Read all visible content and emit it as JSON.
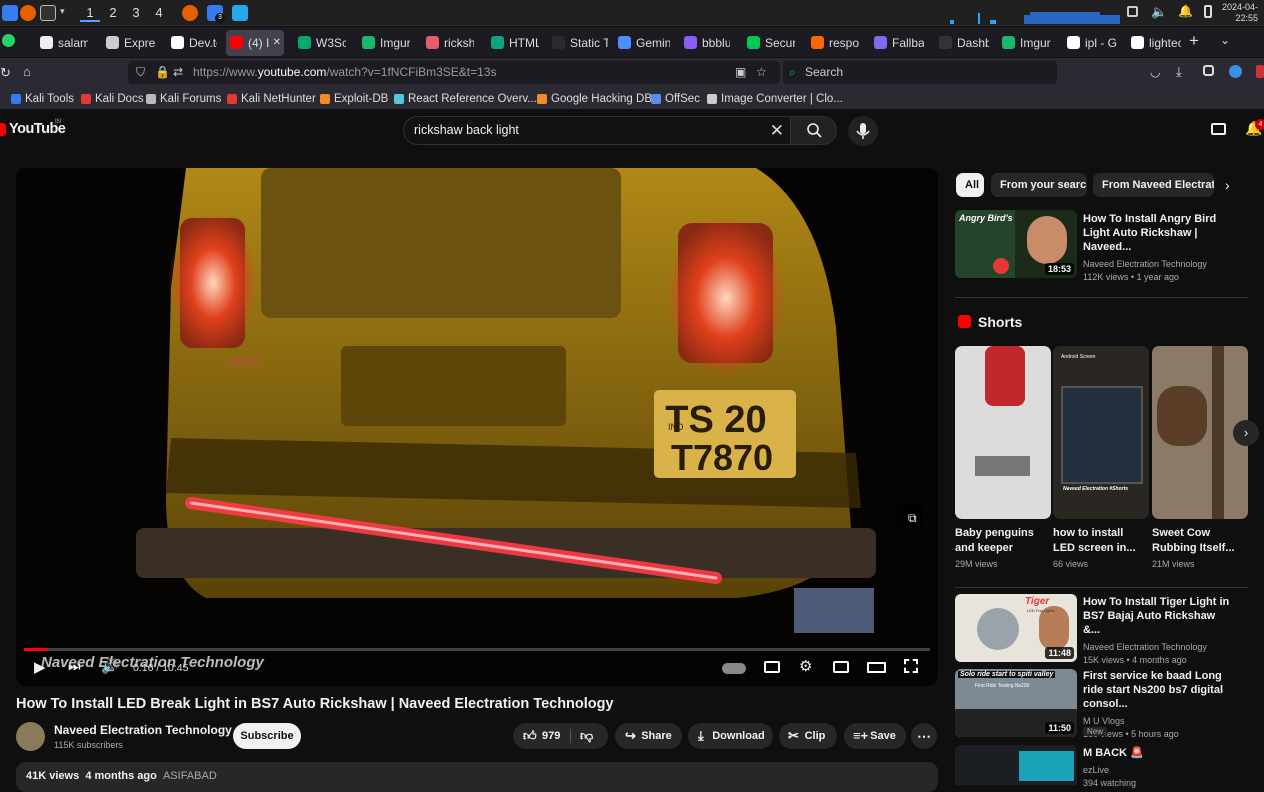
{
  "taskbar": {
    "workspaces": [
      "1",
      "2",
      "3",
      "4"
    ],
    "active_workspace": "1",
    "clock_date": "2024-04-",
    "clock_time": "22:55",
    "badge": "3"
  },
  "browser_tabs": [
    {
      "label": "salam",
      "color": "#eeeeee"
    },
    {
      "label": "Expres",
      "color": "#cccccc"
    },
    {
      "label": "Dev.to",
      "color": "#ffffff"
    },
    {
      "label": "(4) I",
      "color": "#ff0000"
    },
    {
      "label": "W3Sch",
      "color": "#04aa6d"
    },
    {
      "label": "Imgur",
      "color": "#1bb76e"
    },
    {
      "label": "ricksha",
      "color": "#e35d6a"
    },
    {
      "label": "HTML",
      "color": "#10a37f"
    },
    {
      "label": "Static Tem",
      "color": "#2b2a33"
    },
    {
      "label": "Gemini",
      "color": "#4b90ff"
    },
    {
      "label": "bbblur",
      "color": "#8b5cf6"
    },
    {
      "label": "Securi",
      "color": "#00c853"
    },
    {
      "label": "respon",
      "color": "#ff6600"
    },
    {
      "label": "Fallbac",
      "color": "#7c6cf0"
    },
    {
      "label": "Dashbo",
      "color": "#333333"
    },
    {
      "label": "Imgur",
      "color": "#1bb76e"
    },
    {
      "label": "ipl - Go",
      "color": "#ffffff"
    },
    {
      "label": "lightec",
      "color": "#ffffff"
    }
  ],
  "url": {
    "prefix": "https://www.",
    "host": "youtube.com",
    "path": "/watch?v=1fNCFiBm3SE&t=13s"
  },
  "browser_search_placeholder": "Search",
  "bookmarks": [
    {
      "label": "Kali Tools",
      "color": "#367bf0"
    },
    {
      "label": "Kali Docs",
      "color": "#e53935"
    },
    {
      "label": "Kali Forums",
      "color": "#bbbbbb"
    },
    {
      "label": "Kali NetHunter",
      "color": "#e53935"
    },
    {
      "label": "Exploit-DB",
      "color": "#f28c28"
    },
    {
      "label": "React Reference Overv...",
      "color": "#58c4dc"
    },
    {
      "label": "Google Hacking DB",
      "color": "#f28c28"
    },
    {
      "label": "OffSec",
      "color": "#5b8def"
    },
    {
      "label": "Image Converter | Clo...",
      "color": "#cccccc"
    }
  ],
  "yt": {
    "logo": "YouTube",
    "logo_region": "IN",
    "search_value": "rickshaw back light",
    "notif_count": "4"
  },
  "video": {
    "title": "How To Install LED Break Light in BS7 Auto Rickshaw | Naveed Electration Technology",
    "watermark": "Naveed Electration Technology",
    "time": "0:16 / 10:45",
    "progress": 0.025,
    "plate_line1": "TS 20",
    "plate_line2": "T7870",
    "plate_ind": "IND",
    "body_text": "DIESEL"
  },
  "channel": {
    "name": "Naveed Electration Technology",
    "subs": "115K subscribers",
    "subscribe": "Subscribe"
  },
  "actions": {
    "likes": "979",
    "share": "Share",
    "download": "Download",
    "clip": "Clip",
    "save": "Save"
  },
  "description": {
    "views": "41K views",
    "age": "4 months ago",
    "location": "ASIFABAD"
  },
  "chips": [
    "All",
    "From your search",
    "From Naveed Electratio"
  ],
  "related_top": {
    "title": "How To Install Angry Bird Light Auto Rickshaw | Naveed...",
    "channel": "Naveed Electration Technology",
    "meta": "112K views • 1 year ago",
    "duration": "18:53",
    "thumb_text": "Angry Bird's"
  },
  "shorts_heading": "Shorts",
  "shorts": [
    {
      "title": "Baby penguins and keeper",
      "views": "29M views"
    },
    {
      "title": "how to install LED screen in...",
      "views": "66 views",
      "thumb_top": "Android Screen",
      "thumb_bottom": "Naveed Electration #Shorts"
    },
    {
      "title": "Sweet Cow Rubbing Itself...",
      "views": "21M views"
    }
  ],
  "related": [
    {
      "title": "How To Install Tiger Light in BS7 Bajaj Auto Rickshaw &...",
      "channel": "Naveed Electration Technology",
      "meta": "15K views • 4 months ago",
      "duration": "11:48",
      "thumb_text": "Tiger",
      "thumb_sub": "LED Fog Lights"
    },
    {
      "title": "First service ke baad Long ride start Ns200 bs7 digital consol...",
      "channel": "M U Vlogs",
      "meta": "180 views • 5 hours ago",
      "badge": "New",
      "duration": "11:50",
      "thumb_text": "Solo ride start to spiti valley",
      "thumb_sub": "First Ride Testing Ns200"
    },
    {
      "title": "M BACK",
      "channel": "ezLive",
      "meta": "394 watching"
    }
  ]
}
